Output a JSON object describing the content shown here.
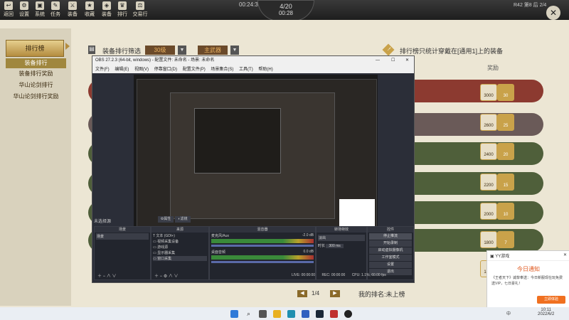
{
  "topbar": {
    "buttons": [
      {
        "label": "返回",
        "icon": "back-icon"
      },
      {
        "label": "设置",
        "icon": "settings-icon"
      },
      {
        "label": "系统",
        "icon": "system-icon"
      },
      {
        "label": "任务",
        "icon": "task-icon"
      },
      {
        "label": "装备",
        "icon": "equip-icon"
      },
      {
        "label": "收藏",
        "icon": "collection-icon"
      },
      {
        "label": "装备",
        "icon": "gear-icon"
      },
      {
        "label": "排行",
        "icon": "rank-icon"
      },
      {
        "label": "交易行",
        "icon": "trade-icon"
      }
    ],
    "time_left": "00:24:31",
    "round": "4/20",
    "countdown": "00:28",
    "right_text": "R42 第8 后 2/4"
  },
  "game": {
    "nav_title": "排行榜",
    "nav_items": [
      "装备排行",
      "装备排行奖励",
      "华山论剑排行",
      "华山论剑排行奖励"
    ],
    "filter_label": "装备排行筛选",
    "filter_level": "30级",
    "filter_type": "主武器",
    "notice": "排行榜只统计穿戴在[通用1]上的装备",
    "reward_header": "奖励",
    "rewards": [
      {
        "silver": "3000",
        "gold": "30"
      },
      {
        "silver": "2600",
        "gold": "25"
      },
      {
        "silver": "2400",
        "gold": "20"
      },
      {
        "silver": "2200",
        "gold": "15"
      },
      {
        "silver": "2000",
        "gold": "10"
      },
      {
        "silver": "1800",
        "gold": "7"
      },
      {
        "silver": "1600",
        "gold": "5"
      }
    ],
    "page": "1/4",
    "my_rank": "我的排名:未上榜"
  },
  "obs": {
    "title": "OBS 27.2.3 (64-bit, windows) - 配置文件: 未命名 - 场景: 未命名",
    "menu": [
      "文件(F)",
      "编辑(E)",
      "视图(V)",
      "停靠窗口(D)",
      "配置文件(P)",
      "场景集合(S)",
      "工具(T)",
      "帮助(H)"
    ],
    "no_source": "未选择源",
    "props_btn": "属性",
    "filter_btn": "滤镜",
    "dock_scenes": "场景",
    "dock_sources": "来源",
    "dock_mixer": "混音器",
    "dock_transitions": "转场特效",
    "dock_controls": "控件",
    "scene_item": "场景",
    "sources": [
      "文本 (GDI+)",
      "视频采集设备",
      "游戏源",
      "显示器采集",
      "窗口采集"
    ],
    "mixer": [
      {
        "name": "麦克风/Aux",
        "db": "-2.0 dB"
      },
      {
        "name": "桌面音频",
        "db": "0.0 dB"
      }
    ],
    "transition_type": "淡出",
    "duration_label": "时长",
    "duration_value": "300 ms",
    "controls": [
      "停止推流",
      "开始录制",
      "启动虚拟摄像机",
      "工作室模式",
      "设置",
      "退出"
    ],
    "status": {
      "live": "LIVE: 00:00:00",
      "rec": "REC: 00:00:00",
      "cpu": "CPU: 1.1%, 60.00 fps"
    }
  },
  "notification": {
    "app": "YY游戏",
    "title": "今日通知",
    "body": "《王者天下》诚挚奉送：今日新服现在玩免费送VIP，七日豪礼！",
    "action": "立即体验"
  },
  "taskbar": {
    "time": "10:11",
    "date": "2022/6/2",
    "lang": "中",
    "icons": [
      "windows-start-icon",
      "search-icon",
      "task-view-icon",
      "file-explorer-icon",
      "edge-icon",
      "store-icon",
      "steam-icon",
      "game-icon",
      "obs-icon"
    ]
  }
}
